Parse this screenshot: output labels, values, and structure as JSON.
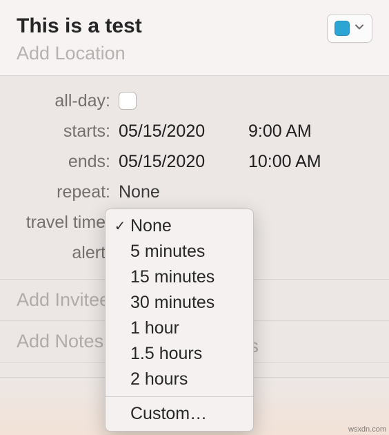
{
  "header": {
    "title": "This is a test",
    "location_placeholder": "Add Location"
  },
  "calendar_picker": {
    "color": "#2ca4d4"
  },
  "fields": {
    "all_day": {
      "label": "all-day:",
      "checked": false
    },
    "starts": {
      "label": "starts:",
      "date": "05/15/2020",
      "time": "9:00 AM"
    },
    "ends": {
      "label": "ends:",
      "date": "05/15/2020",
      "time": "10:00 AM"
    },
    "repeat": {
      "label": "repeat:",
      "value": "None"
    },
    "travel_time": {
      "label": "travel time:"
    },
    "alert": {
      "label": "alert:"
    }
  },
  "sections": {
    "invitees_placeholder": "Add Invitees",
    "notes_placeholder": "Add Notes",
    "attachments_hint": "ents"
  },
  "popup": {
    "selected_index": 0,
    "items": [
      "None",
      "5 minutes",
      "15 minutes",
      "30 minutes",
      "1 hour",
      "1.5 hours",
      "2 hours"
    ],
    "custom_label": "Custom…"
  },
  "watermark": "wsxdn.com"
}
